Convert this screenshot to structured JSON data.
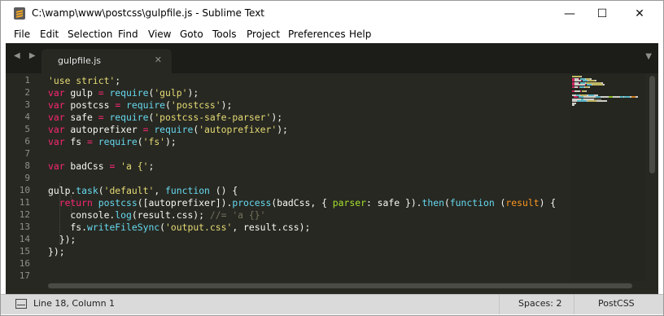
{
  "window": {
    "title": "C:\\wamp\\www\\postcss\\gulpfile.js - Sublime Text",
    "minimize_glyph": "—",
    "maximize_glyph": "☐",
    "close_glyph": "✕"
  },
  "menu": [
    "File",
    "Edit",
    "Selection",
    "Find",
    "View",
    "Goto",
    "Tools",
    "Project",
    "Preferences",
    "Help"
  ],
  "tabbar": {
    "nav_glyph": "◀ ▶",
    "tab_label": "gulpfile.js",
    "close_glyph": "✕",
    "dropdown_glyph": "▼"
  },
  "editor": {
    "line_numbers": [
      "1",
      "2",
      "3",
      "4",
      "5",
      "6",
      "7",
      "8",
      "9",
      "10",
      "11",
      "12",
      "13",
      "14",
      "15",
      "16",
      "17"
    ],
    "lines": [
      [
        [
          "'use strict'",
          "#e6db74"
        ],
        [
          ";",
          "#f8f8f2"
        ]
      ],
      [
        [
          "var",
          "#f92672"
        ],
        [
          " gulp ",
          "#f8f8f2"
        ],
        [
          "=",
          "#f92672"
        ],
        [
          " ",
          "#f8f8f2"
        ],
        [
          "require",
          "#66d9ef"
        ],
        [
          "(",
          "#f8f8f2"
        ],
        [
          "'gulp'",
          "#e6db74"
        ],
        [
          ");",
          "#f8f8f2"
        ]
      ],
      [
        [
          "var",
          "#f92672"
        ],
        [
          " postcss ",
          "#f8f8f2"
        ],
        [
          "=",
          "#f92672"
        ],
        [
          " ",
          "#f8f8f2"
        ],
        [
          "require",
          "#66d9ef"
        ],
        [
          "(",
          "#f8f8f2"
        ],
        [
          "'postcss'",
          "#e6db74"
        ],
        [
          ");",
          "#f8f8f2"
        ]
      ],
      [
        [
          "var",
          "#f92672"
        ],
        [
          " safe ",
          "#f8f8f2"
        ],
        [
          "=",
          "#f92672"
        ],
        [
          " ",
          "#f8f8f2"
        ],
        [
          "require",
          "#66d9ef"
        ],
        [
          "(",
          "#f8f8f2"
        ],
        [
          "'postcss-safe-parser'",
          "#e6db74"
        ],
        [
          ");",
          "#f8f8f2"
        ]
      ],
      [
        [
          "var",
          "#f92672"
        ],
        [
          " autoprefixer ",
          "#f8f8f2"
        ],
        [
          "=",
          "#f92672"
        ],
        [
          " ",
          "#f8f8f2"
        ],
        [
          "require",
          "#66d9ef"
        ],
        [
          "(",
          "#f8f8f2"
        ],
        [
          "'autoprefixer'",
          "#e6db74"
        ],
        [
          ");",
          "#f8f8f2"
        ]
      ],
      [
        [
          "var",
          "#f92672"
        ],
        [
          " fs ",
          "#f8f8f2"
        ],
        [
          "=",
          "#f92672"
        ],
        [
          " ",
          "#f8f8f2"
        ],
        [
          "require",
          "#66d9ef"
        ],
        [
          "(",
          "#f8f8f2"
        ],
        [
          "'fs'",
          "#e6db74"
        ],
        [
          ");",
          "#f8f8f2"
        ]
      ],
      [],
      [
        [
          "var",
          "#f92672"
        ],
        [
          " badCss ",
          "#f8f8f2"
        ],
        [
          "=",
          "#f92672"
        ],
        [
          " ",
          "#f8f8f2"
        ],
        [
          "'a {'",
          "#e6db74"
        ],
        [
          ";",
          "#f8f8f2"
        ]
      ],
      [],
      [
        [
          "gulp.",
          "#f8f8f2"
        ],
        [
          "task",
          "#66d9ef"
        ],
        [
          "(",
          "#f8f8f2"
        ],
        [
          "'default'",
          "#e6db74"
        ],
        [
          ", ",
          "#f8f8f2"
        ],
        [
          "function",
          "#66d9ef"
        ],
        [
          " () {",
          "#f8f8f2"
        ]
      ],
      [
        [
          "  ",
          "#f8f8f2"
        ],
        [
          "return",
          "#f92672"
        ],
        [
          " ",
          "#f8f8f2"
        ],
        [
          "postcss",
          "#66d9ef"
        ],
        [
          "([autoprefixer]).",
          "#f8f8f2"
        ],
        [
          "process",
          "#66d9ef"
        ],
        [
          "(badCss, { ",
          "#f8f8f2"
        ],
        [
          "parser",
          "#a6e22e"
        ],
        [
          ": safe }).",
          "#f8f8f2"
        ],
        [
          "then",
          "#66d9ef"
        ],
        [
          "(",
          "#f8f8f2"
        ],
        [
          "function",
          "#66d9ef"
        ],
        [
          " (",
          "#f8f8f2"
        ],
        [
          "result",
          "#fd971f"
        ],
        [
          ") {",
          "#f8f8f2"
        ]
      ],
      [
        [
          "    console.",
          "#f8f8f2"
        ],
        [
          "log",
          "#66d9ef"
        ],
        [
          "(result.css); ",
          "#f8f8f2"
        ],
        [
          "//= 'a {}'",
          "#75715e"
        ]
      ],
      [
        [
          "    fs.",
          "#f8f8f2"
        ],
        [
          "writeFileSync",
          "#66d9ef"
        ],
        [
          "(",
          "#f8f8f2"
        ],
        [
          "'output.css'",
          "#e6db74"
        ],
        [
          ", result.css);",
          "#f8f8f2"
        ]
      ],
      [
        [
          "  });",
          "#f8f8f2"
        ]
      ],
      [
        [
          "});",
          "#f8f8f2"
        ]
      ],
      [],
      []
    ]
  },
  "statusbar": {
    "position": "Line 18, Column 1",
    "spaces": "Spaces: 2",
    "syntax": "PostCSS"
  },
  "colors": {
    "editor_bg": "#272822",
    "keyword": "#f92672",
    "string": "#e6db74",
    "function": "#66d9ef",
    "comment": "#75715e"
  }
}
